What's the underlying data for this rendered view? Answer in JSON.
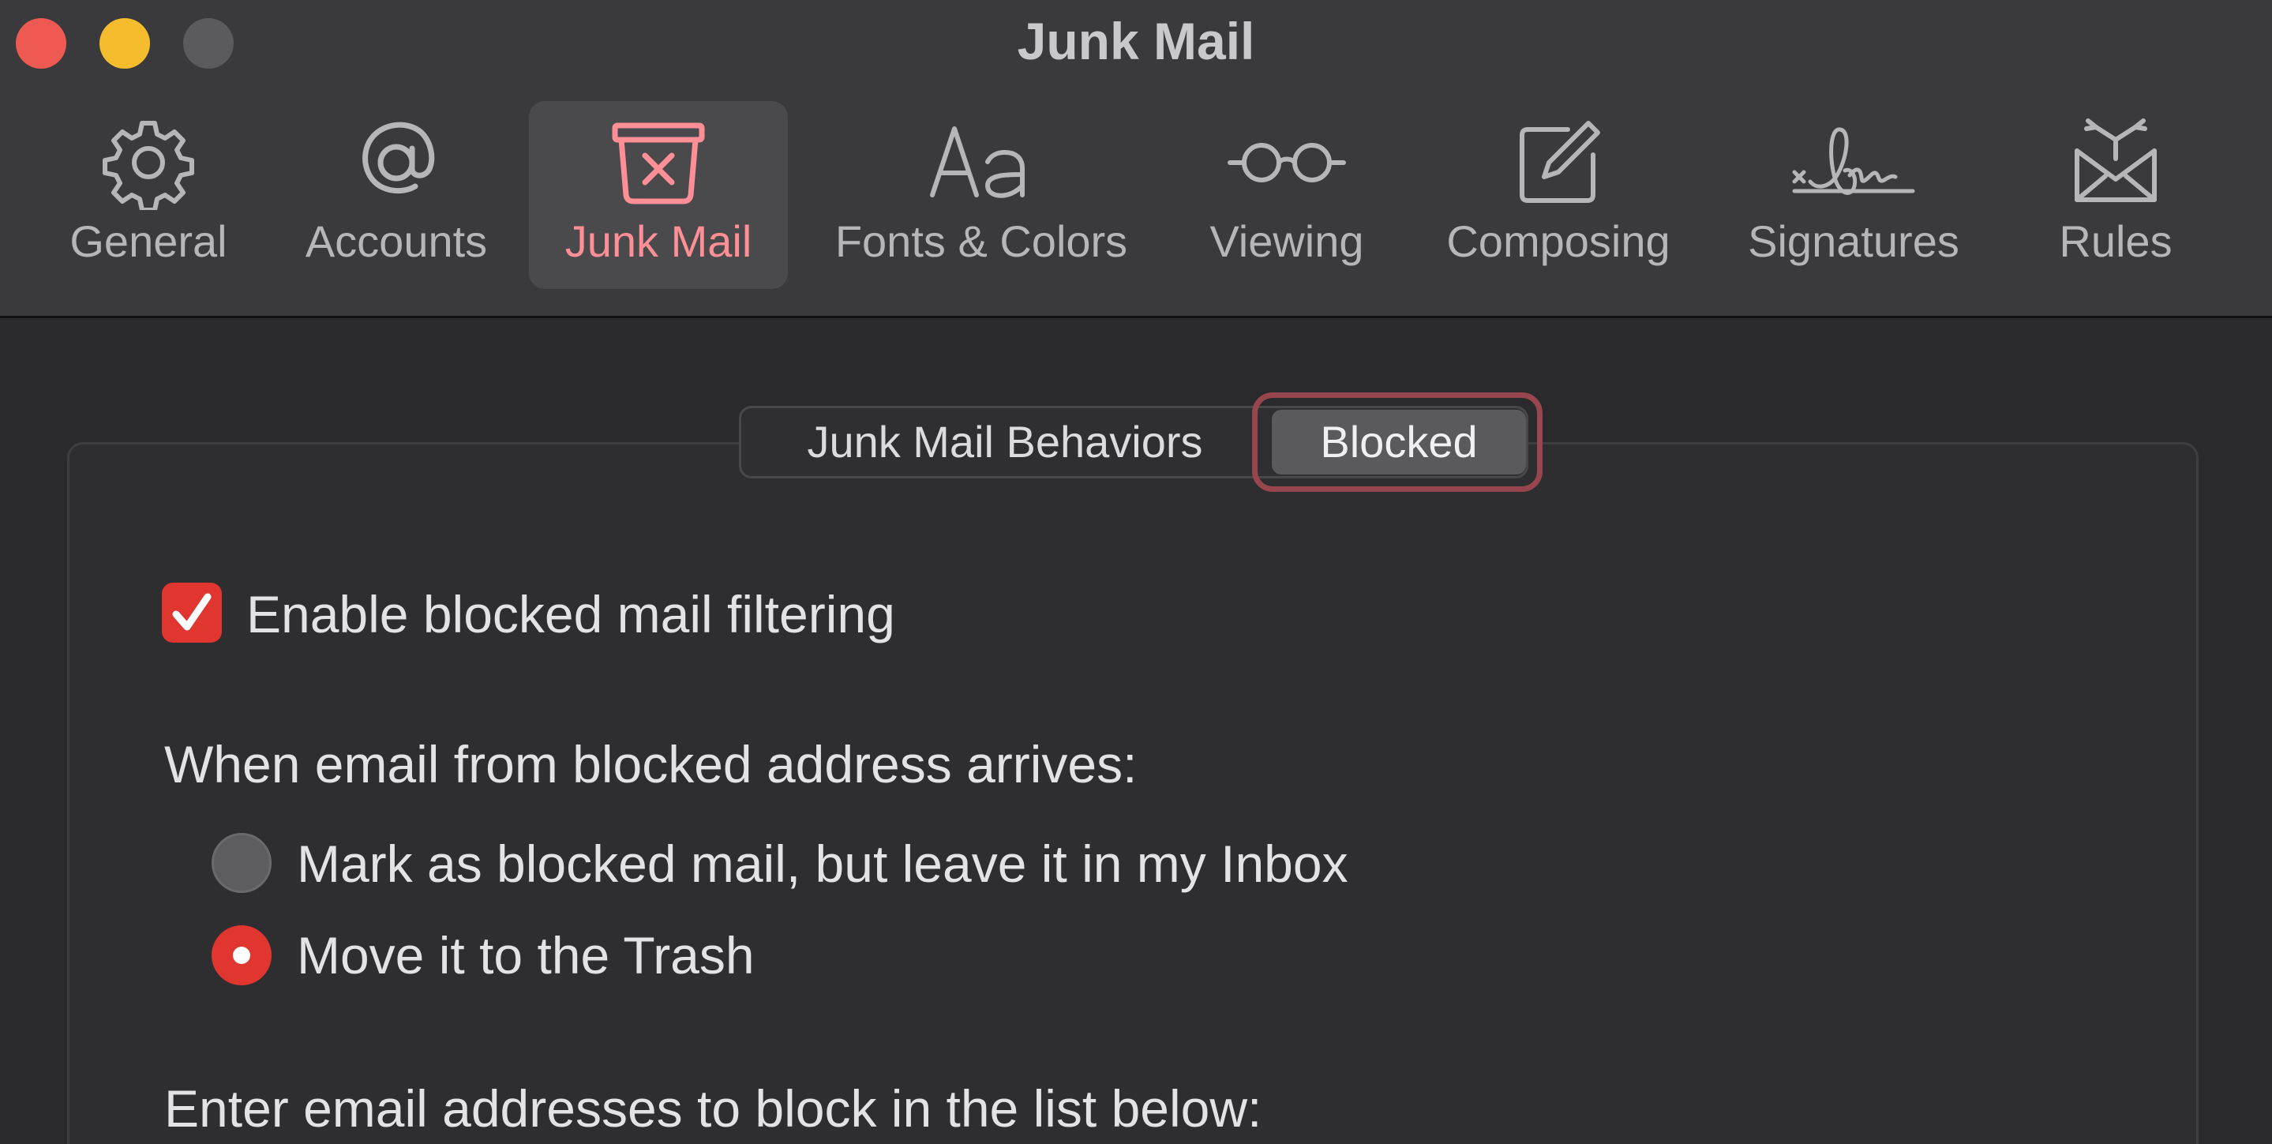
{
  "window": {
    "title": "Junk Mail",
    "accent_color": "#e0362f"
  },
  "toolbar": {
    "items": [
      {
        "label": "General",
        "icon": "gear-icon",
        "selected": false
      },
      {
        "label": "Accounts",
        "icon": "at-sign-icon",
        "selected": false
      },
      {
        "label": "Junk Mail",
        "icon": "junk-bin-icon",
        "selected": true
      },
      {
        "label": "Fonts & Colors",
        "icon": "font-aa-icon",
        "selected": false
      },
      {
        "label": "Viewing",
        "icon": "glasses-icon",
        "selected": false
      },
      {
        "label": "Composing",
        "icon": "compose-icon",
        "selected": false
      },
      {
        "label": "Signatures",
        "icon": "signature-icon",
        "selected": false
      },
      {
        "label": "Rules",
        "icon": "rules-envelope-icon",
        "selected": false
      }
    ]
  },
  "segmented": {
    "tabs": [
      "Junk Mail Behaviors",
      "Blocked"
    ],
    "selected": "Blocked"
  },
  "form": {
    "enable_filtering": {
      "label": "Enable blocked mail filtering",
      "checked": true
    },
    "arrival_heading": "When email from blocked address arrives:",
    "options": [
      {
        "label": "Mark as blocked mail, but leave it in my Inbox",
        "selected": false
      },
      {
        "label": "Move it to the Trash",
        "selected": true
      }
    ],
    "list_heading": "Enter email addresses to block in the list below:"
  }
}
